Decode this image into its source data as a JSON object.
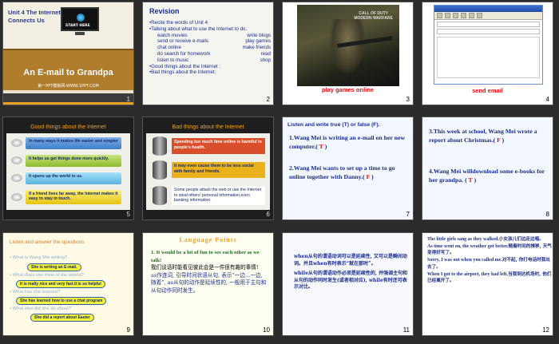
{
  "slides": {
    "s1": {
      "num": "1",
      "unit_title_line1": "Unit 4 The Internet",
      "unit_title_line2": "Connects Us",
      "monitor_text": "START HERE",
      "main_title": "An E-mail to Grandpa",
      "footer_text": "第一PPT模板网-WWW.1PPT.COM"
    },
    "s2": {
      "num": "2",
      "heading": "Revision",
      "line1": "Recite the words of Unit 4",
      "line2": "Talking about what to use the Internet to do.",
      "pairs": [
        [
          "watch movies",
          "write blogs"
        ],
        [
          "send or receive e-mails",
          "play games"
        ],
        [
          "chat online",
          "make friends"
        ],
        [
          "do search for homework",
          "read"
        ],
        [
          "listen to music",
          "shop"
        ]
      ],
      "line3": "Good things about the Internet :",
      "line4": "Bad things about the Internet:"
    },
    "s3": {
      "num": "3",
      "logo_line1": "CALL OF DUTY",
      "logo_line2": "MODERN WARFARE",
      "caption": "play games online"
    },
    "s4": {
      "num": "4",
      "caption": "send email"
    },
    "s5": {
      "num": "5",
      "heading": "Good things about the Internet",
      "items": [
        "In many ways it makes life easier and simpler .",
        "It helps us get things done more quickly.",
        "It opens up the world to us.",
        "If a friend lives far away, the  Internet makes it easy to stay in touch."
      ]
    },
    "s6": {
      "num": "6",
      "heading": "Bad things  about the Internet",
      "items": [
        "Spending too much time online is harmful to people's health.",
        "It may even cause them to be less social with family and friends.",
        "Some people attack the web or use the Internet to  steal others' personal information,even banking information."
      ]
    },
    "s7": {
      "num": "7",
      "heading": "Listen and write true (T) or false (F).",
      "q1": "1.Wang Mei is writing an e-mail on her new computer.(",
      "a1": " T ",
      "q2": "2.Wang Mei wants to set up a time to go online together with Danny.(",
      "a2": " F ",
      "close": ")"
    },
    "s8": {
      "num": "8",
      "q3": "3.This week at school, Wang Mei wrote a report about Christmas.(",
      "a3": " F ",
      "q4": "4.Wang Mei willdownload some e-books for her grandpa. (",
      "a4": " T ",
      "close": ")"
    },
    "s9": {
      "num": "9",
      "heading": "Listen and answer the questions",
      "q1": "• What is Wang Mei writing?",
      "a1": "She is writing an E-mail.",
      "q2": "• What does she think of the laptop?",
      "a2": "It is really nice and very fast.It is so helpful",
      "q3": "• What has she learned?",
      "a3": "She has learned how to use a chat program",
      "q4": "• What else did she do about?",
      "a4": "She did a report about Easter"
    },
    "s10": {
      "num": "10",
      "heading": "Language Points",
      "p1": "1. It would be a lot of fun to see each other as we talk!",
      "p2": "我们谈话时能看见彼此会是一件很有趣的事情!",
      "p3": "as作连词, 引导时间状语从句, 表示“一边…一边, 随着”, as从句的动作是延续性的, 一般用于主句和从句动作同时发生。"
    },
    "s11": {
      "num": "11",
      "p1": "when从句的谓语动词可以是延续性, 又可以是瞬间动词。并且when有时表示“就在那时”。",
      "p2": "while从句的谓语动作必须是延续性的, 并强调主句和从句的动作同时发生(或者相对应), while有时还可表示对比。"
    },
    "s12": {
      "num": "12",
      "l1_en": "The little girls sang as they walked.",
      "l1_cn": "小女孩儿们边走边唱。",
      "l2_en": "As time went on, the weather got better.",
      "l2_cn": "随着时间的推移, 天气变得好写了。",
      "l3_en": "Sorry, I was out when you called me.",
      "l3_cn": "对不起, 你打电话时我出去了。",
      "l4_en": "When I got to the airport, they had left.",
      "l4_cn": "当我到达机场时, 他们已经离开了。"
    }
  }
}
